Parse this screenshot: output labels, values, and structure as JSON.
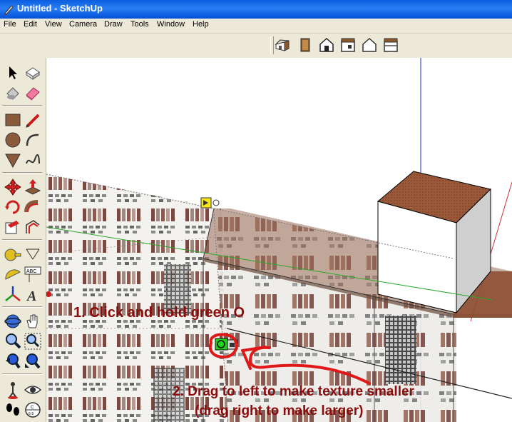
{
  "window": {
    "title": "Untitled - SketchUp"
  },
  "menu": [
    "File",
    "Edit",
    "View",
    "Camera",
    "Draw",
    "Tools",
    "Window",
    "Help"
  ],
  "views_toolbar": [
    "iso-view",
    "top-view",
    "front-view",
    "right-view",
    "back-view",
    "left-view"
  ],
  "tools": [
    [
      "select-tool",
      "component-tool"
    ],
    [
      "paint-bucket-tool",
      "eraser-tool"
    ],
    [
      "rectangle-tool",
      "line-tool"
    ],
    [
      "circle-tool",
      "arc-tool"
    ],
    [
      "polygon-tool",
      "freehand-tool"
    ],
    [
      "move-tool",
      "push-pull-tool"
    ],
    [
      "rotate-tool",
      "follow-me-tool"
    ],
    [
      "scale-tool",
      "offset-tool"
    ],
    [
      "tape-measure-tool",
      "dimension-tool"
    ],
    [
      "protractor-tool",
      "text-tool"
    ],
    [
      "axes-tool",
      "3d-text-tool"
    ],
    [
      "orbit-tool",
      "pan-tool"
    ],
    [
      "zoom-tool",
      "zoom-window-tool"
    ],
    [
      "previous-view-tool",
      "zoom-extents-tool"
    ],
    [
      "position-camera-tool",
      "look-around-tool"
    ],
    [
      "walk-tool",
      "section-plane-tool"
    ]
  ],
  "annotations": {
    "step1": "1.  Click and hold green O",
    "step2": "2.  Drag to left to make texture smaller",
    "step2b": "(drag right to make larger)"
  },
  "colors": {
    "annotation": "#8b0c0c",
    "pin_green": "#22d11c",
    "title_bar": "#0a5fe0"
  }
}
